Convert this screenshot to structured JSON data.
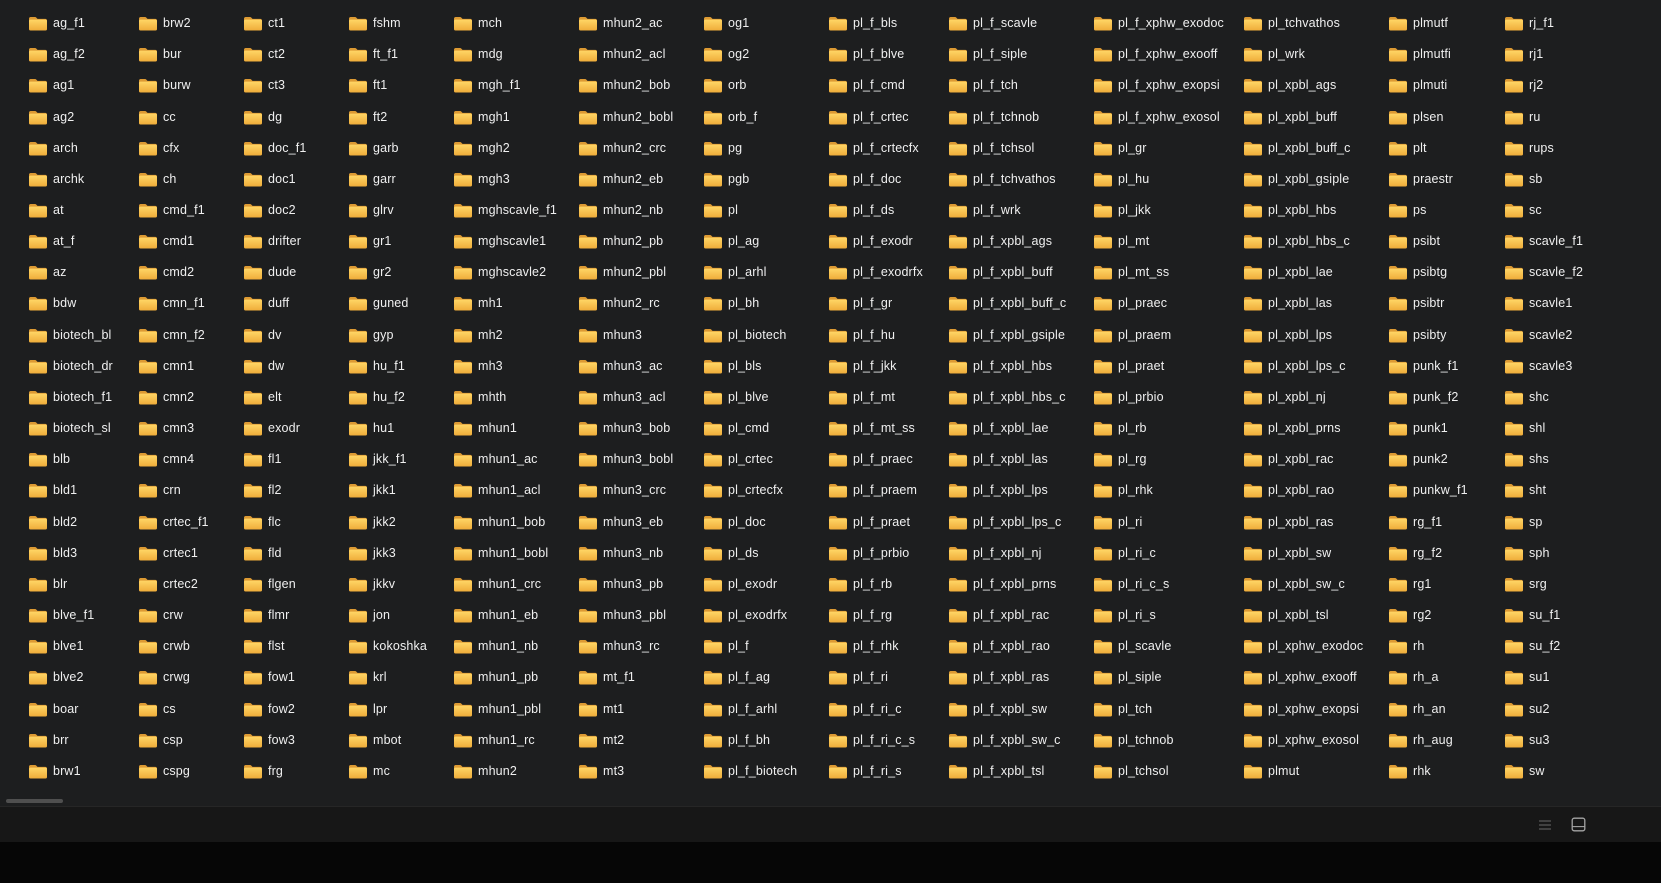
{
  "app": {
    "name": "file-explorer",
    "view_mode": "list"
  },
  "theme": {
    "background": "#1d1e1f",
    "statusbar_background": "#171717",
    "window_bottom": "#060606",
    "text_color": "#f0f0f0",
    "folder_back": "#dd9a33",
    "folder_gradient_top": "#ffd666",
    "folder_gradient_bottom": "#efac3a",
    "scrollbar_thumb": "#4f4f4f"
  },
  "statusbar": {
    "icons": [
      "details-view-icon",
      "thumbnails-view-icon"
    ]
  },
  "columns": [
    {
      "items": [
        "ag_f1",
        "ag_f2",
        "ag1",
        "ag2",
        "arch",
        "archk",
        "at",
        "at_f",
        "az",
        "bdw",
        "biotech_bl",
        "biotech_dr",
        "biotech_f1",
        "biotech_sl",
        "blb",
        "bld1",
        "bld2",
        "bld3",
        "blr",
        "blve_f1",
        "blve1",
        "blve2",
        "boar",
        "brr",
        "brw1"
      ]
    },
    {
      "items": [
        "brw2",
        "bur",
        "burw",
        "cc",
        "cfx",
        "ch",
        "cmd_f1",
        "cmd1",
        "cmd2",
        "cmn_f1",
        "cmn_f2",
        "cmn1",
        "cmn2",
        "cmn3",
        "cmn4",
        "crn",
        "crtec_f1",
        "crtec1",
        "crtec2",
        "crw",
        "crwb",
        "crwg",
        "cs",
        "csp",
        "cspg"
      ]
    },
    {
      "items": [
        "ct1",
        "ct2",
        "ct3",
        "dg",
        "doc_f1",
        "doc1",
        "doc2",
        "drifter",
        "dude",
        "duff",
        "dv",
        "dw",
        "elt",
        "exodr",
        "fl1",
        "fl2",
        "flc",
        "fld",
        "flgen",
        "flmr",
        "flst",
        "fow1",
        "fow2",
        "fow3",
        "frg"
      ]
    },
    {
      "items": [
        "fshm",
        "ft_f1",
        "ft1",
        "ft2",
        "garb",
        "garr",
        "glrv",
        "gr1",
        "gr2",
        "guned",
        "gyp",
        "hu_f1",
        "hu_f2",
        "hu1",
        "jkk_f1",
        "jkk1",
        "jkk2",
        "jkk3",
        "jkkv",
        "jon",
        "kokoshka",
        "krl",
        "lpr",
        "mbot",
        "mc"
      ]
    },
    {
      "items": [
        "mch",
        "mdg",
        "mgh_f1",
        "mgh1",
        "mgh2",
        "mgh3",
        "mghscavle_f1",
        "mghscavle1",
        "mghscavle2",
        "mh1",
        "mh2",
        "mh3",
        "mhth",
        "mhun1",
        "mhun1_ac",
        "mhun1_acl",
        "mhun1_bob",
        "mhun1_bobl",
        "mhun1_crc",
        "mhun1_eb",
        "mhun1_nb",
        "mhun1_pb",
        "mhun1_pbl",
        "mhun1_rc",
        "mhun2"
      ]
    },
    {
      "items": [
        "mhun2_ac",
        "mhun2_acl",
        "mhun2_bob",
        "mhun2_bobl",
        "mhun2_crc",
        "mhun2_eb",
        "mhun2_nb",
        "mhun2_pb",
        "mhun2_pbl",
        "mhun2_rc",
        "mhun3",
        "mhun3_ac",
        "mhun3_acl",
        "mhun3_bob",
        "mhun3_bobl",
        "mhun3_crc",
        "mhun3_eb",
        "mhun3_nb",
        "mhun3_pb",
        "mhun3_pbl",
        "mhun3_rc",
        "mt_f1",
        "mt1",
        "mt2",
        "mt3"
      ]
    },
    {
      "items": [
        "og1",
        "og2",
        "orb",
        "orb_f",
        "pg",
        "pgb",
        "pl",
        "pl_ag",
        "pl_arhl",
        "pl_bh",
        "pl_biotech",
        "pl_bls",
        "pl_blve",
        "pl_cmd",
        "pl_crtec",
        "pl_crtecfx",
        "pl_doc",
        "pl_ds",
        "pl_exodr",
        "pl_exodrfx",
        "pl_f",
        "pl_f_ag",
        "pl_f_arhl",
        "pl_f_bh",
        "pl_f_biotech"
      ]
    },
    {
      "items": [
        "pl_f_bls",
        "pl_f_blve",
        "pl_f_cmd",
        "pl_f_crtec",
        "pl_f_crtecfx",
        "pl_f_doc",
        "pl_f_ds",
        "pl_f_exodr",
        "pl_f_exodrfx",
        "pl_f_gr",
        "pl_f_hu",
        "pl_f_jkk",
        "pl_f_mt",
        "pl_f_mt_ss",
        "pl_f_praec",
        "pl_f_praem",
        "pl_f_praet",
        "pl_f_prbio",
        "pl_f_rb",
        "pl_f_rg",
        "pl_f_rhk",
        "pl_f_ri",
        "pl_f_ri_c",
        "pl_f_ri_c_s",
        "pl_f_ri_s"
      ]
    },
    {
      "items": [
        "pl_f_scavle",
        "pl_f_siple",
        "pl_f_tch",
        "pl_f_tchnob",
        "pl_f_tchsol",
        "pl_f_tchvathos",
        "pl_f_wrk",
        "pl_f_xpbl_ags",
        "pl_f_xpbl_buff",
        "pl_f_xpbl_buff_c",
        "pl_f_xpbl_gsiple",
        "pl_f_xpbl_hbs",
        "pl_f_xpbl_hbs_c",
        "pl_f_xpbl_lae",
        "pl_f_xpbl_las",
        "pl_f_xpbl_lps",
        "pl_f_xpbl_lps_c",
        "pl_f_xpbl_nj",
        "pl_f_xpbl_prns",
        "pl_f_xpbl_rac",
        "pl_f_xpbl_rao",
        "pl_f_xpbl_ras",
        "pl_f_xpbl_sw",
        "pl_f_xpbl_sw_c",
        "pl_f_xpbl_tsl"
      ]
    },
    {
      "items": [
        "pl_f_xphw_exodoc",
        "pl_f_xphw_exooff",
        "pl_f_xphw_exopsi",
        "pl_f_xphw_exosol",
        "pl_gr",
        "pl_hu",
        "pl_jkk",
        "pl_mt",
        "pl_mt_ss",
        "pl_praec",
        "pl_praem",
        "pl_praet",
        "pl_prbio",
        "pl_rb",
        "pl_rg",
        "pl_rhk",
        "pl_ri",
        "pl_ri_c",
        "pl_ri_c_s",
        "pl_ri_s",
        "pl_scavle",
        "pl_siple",
        "pl_tch",
        "pl_tchnob",
        "pl_tchsol"
      ]
    },
    {
      "items": [
        "pl_tchvathos",
        "pl_wrk",
        "pl_xpbl_ags",
        "pl_xpbl_buff",
        "pl_xpbl_buff_c",
        "pl_xpbl_gsiple",
        "pl_xpbl_hbs",
        "pl_xpbl_hbs_c",
        "pl_xpbl_lae",
        "pl_xpbl_las",
        "pl_xpbl_lps",
        "pl_xpbl_lps_c",
        "pl_xpbl_nj",
        "pl_xpbl_prns",
        "pl_xpbl_rac",
        "pl_xpbl_rao",
        "pl_xpbl_ras",
        "pl_xpbl_sw",
        "pl_xpbl_sw_c",
        "pl_xpbl_tsl",
        "pl_xphw_exodoc",
        "pl_xphw_exooff",
        "pl_xphw_exopsi",
        "pl_xphw_exosol",
        "plmut"
      ]
    },
    {
      "items": [
        "plmutf",
        "plmutfi",
        "plmuti",
        "plsen",
        "plt",
        "praestr",
        "ps",
        "psibt",
        "psibtg",
        "psibtr",
        "psibty",
        "punk_f1",
        "punk_f2",
        "punk1",
        "punk2",
        "punkw_f1",
        "rg_f1",
        "rg_f2",
        "rg1",
        "rg2",
        "rh",
        "rh_a",
        "rh_an",
        "rh_aug",
        "rhk"
      ]
    },
    {
      "items": [
        "rj_f1",
        "rj1",
        "rj2",
        "ru",
        "rups",
        "sb",
        "sc",
        "scavle_f1",
        "scavle_f2",
        "scavle1",
        "scavle2",
        "scavle3",
        "shc",
        "shl",
        "shs",
        "sht",
        "sp",
        "sph",
        "srg",
        "su_f1",
        "su_f2",
        "su1",
        "su2",
        "su3",
        "sw"
      ]
    }
  ]
}
